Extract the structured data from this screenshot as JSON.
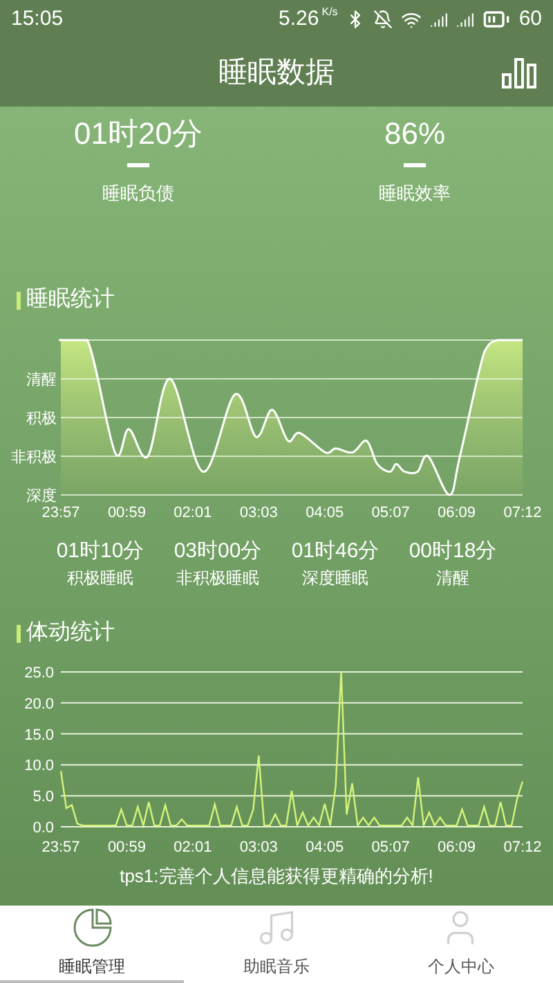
{
  "status_bar": {
    "time": "15:05",
    "speed": "5.26",
    "speed_unit": "K/s",
    "battery": "60"
  },
  "header": {
    "title": "睡眠数据"
  },
  "summary": [
    {
      "value": "01时20分",
      "label": "睡眠负债"
    },
    {
      "value": "86%",
      "label": "睡眠效率"
    }
  ],
  "sleep_stats": {
    "title": "睡眠统计",
    "y_labels": [
      "清醒",
      "积极",
      "非积极",
      "深度"
    ],
    "x_labels": [
      "23:57",
      "00:59",
      "02:01",
      "03:03",
      "04:05",
      "05:07",
      "06:09",
      "07:12"
    ],
    "totals": [
      {
        "value": "01时10分",
        "label": "积极睡眠"
      },
      {
        "value": "03时00分",
        "label": "非积极睡眠"
      },
      {
        "value": "01时46分",
        "label": "深度睡眠"
      },
      {
        "value": "00时18分",
        "label": "清醒"
      }
    ]
  },
  "movement_stats": {
    "title": "体动统计",
    "chart_data": {
      "type": "line",
      "grid": true,
      "categories": [
        "23:57",
        null,
        null,
        null,
        null,
        null,
        null,
        null,
        null,
        null,
        null,
        null,
        "00:59",
        null,
        null,
        null,
        null,
        null,
        null,
        null,
        null,
        null,
        null,
        null,
        "02:01",
        null,
        null,
        null,
        null,
        null,
        null,
        null,
        null,
        null,
        null,
        null,
        "03:03",
        null,
        null,
        null,
        null,
        null,
        null,
        null,
        null,
        null,
        null,
        null,
        "04:05",
        null,
        null,
        null,
        null,
        null,
        null,
        null,
        null,
        null,
        null,
        null,
        "05:07",
        null,
        null,
        null,
        null,
        null,
        null,
        null,
        null,
        null,
        null,
        null,
        "06:09",
        null,
        null,
        null,
        null,
        null,
        null,
        null,
        null,
        null,
        null,
        null,
        "07:12"
      ],
      "series": [
        {
          "color": "#d4f47a",
          "values": [
            9,
            3,
            3.5,
            0.5,
            0.2,
            0.2,
            0.2,
            0.2,
            0.2,
            0.2,
            0.2,
            2.8,
            0.2,
            0.2,
            3.2,
            0.2,
            4,
            0.2,
            0.2,
            3.5,
            0.2,
            0.2,
            1.2,
            0.2,
            0.2,
            0.2,
            0.2,
            0.2,
            3.6,
            0.2,
            0.2,
            0.2,
            3.2,
            0.2,
            0.2,
            2.8,
            11.5,
            0.2,
            0.2,
            2,
            0.2,
            0.2,
            5.8,
            0.2,
            2.3,
            0.2,
            1.5,
            0.2,
            3.7,
            0.2,
            6.5,
            25,
            2,
            7,
            0.2,
            1.5,
            0.2,
            1.5,
            0.2,
            0.2,
            0.2,
            0.2,
            0.2,
            1.5,
            0.2,
            8,
            0.2,
            2.3,
            0.2,
            1.5,
            0.2,
            0.2,
            0.2,
            2.8,
            0.2,
            0.2,
            0.2,
            3.2,
            0.2,
            0.2,
            4,
            0.2,
            0.2,
            4.5,
            7.3
          ]
        }
      ],
      "ylim": [
        0,
        25
      ],
      "yticks": [
        {
          "value": 0,
          "label": "0.0"
        },
        {
          "value": 5,
          "label": "5.0"
        },
        {
          "value": 10,
          "label": "10.0"
        },
        {
          "value": 15,
          "label": "15.0"
        },
        {
          "value": 20,
          "label": "20.0"
        },
        {
          "value": 25,
          "label": "25.0"
        }
      ]
    }
  },
  "tip": "tps1:完善个人信息能获得更精确的分析!",
  "tabs": [
    {
      "kind": "chart",
      "label": "睡眠管理",
      "selected": true
    },
    {
      "kind": "music",
      "label": "助眠音乐",
      "selected": false
    },
    {
      "kind": "person",
      "label": "个人中心",
      "selected": false
    }
  ]
}
